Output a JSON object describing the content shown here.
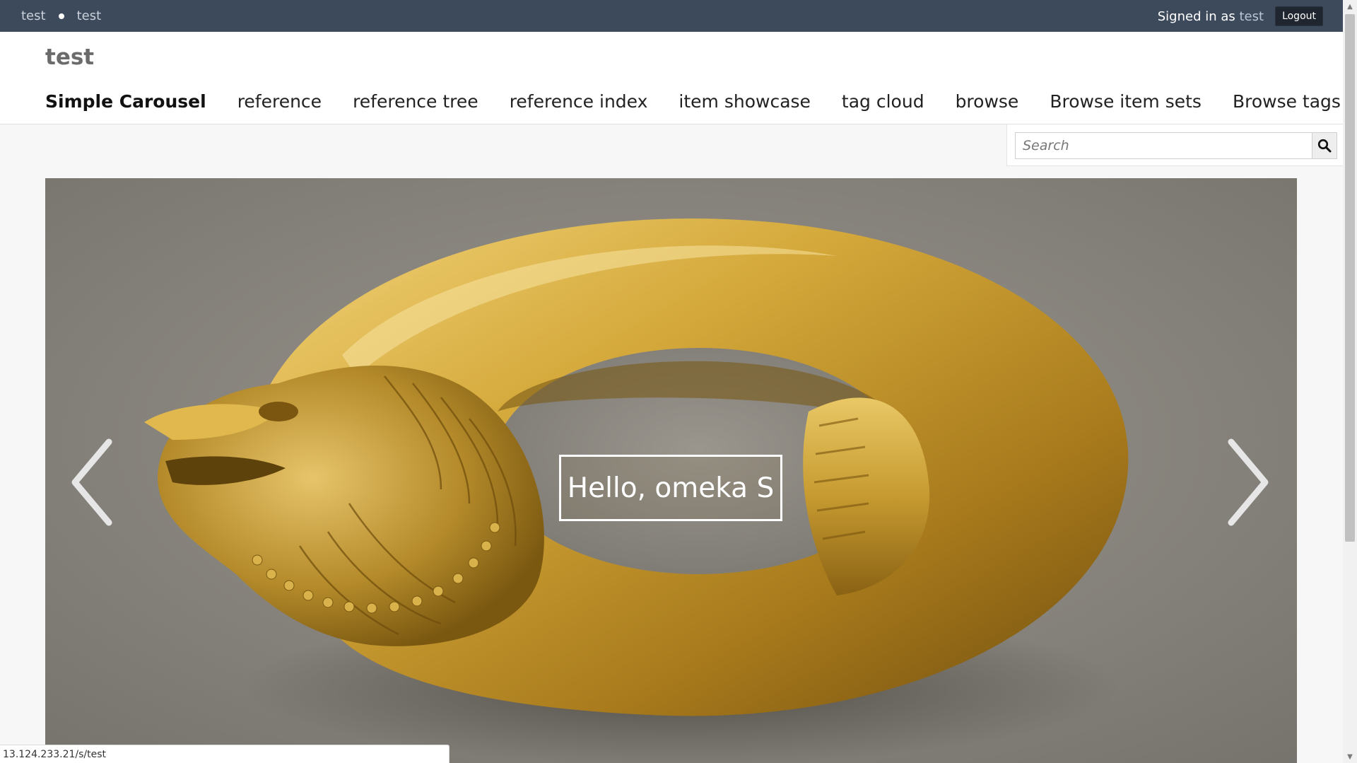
{
  "topbar": {
    "crumb_site": "test",
    "crumb_page": "test",
    "signed_in_prefix": "Signed in as ",
    "username": "test",
    "logout_label": "Logout"
  },
  "header": {
    "site_title": "test",
    "nav": [
      "Simple Carousel",
      "reference",
      "reference tree",
      "reference index",
      "item showcase",
      "tag cloud",
      "browse",
      "Browse item sets",
      "Browse tags"
    ],
    "active_nav": "Simple Carousel"
  },
  "search": {
    "placeholder": "Search",
    "button_icon": "search-icon"
  },
  "carousel": {
    "caption": "Hello, omeka S",
    "prev_icon": "chevron-left-icon",
    "next_icon": "chevron-right-icon"
  },
  "status": {
    "url": "13.124.233.21/s/test"
  },
  "colors": {
    "topbar_bg": "#3d4a5c",
    "header_bg": "#ffffff",
    "page_bg": "#f7f7f7",
    "gold": "#c8a030"
  }
}
